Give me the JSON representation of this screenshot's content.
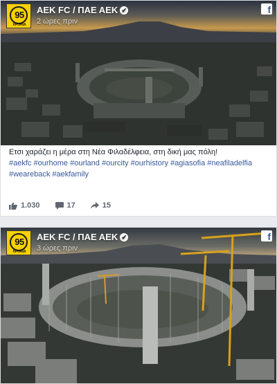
{
  "posts": [
    {
      "page_name": "AEK FC / ΠΑΕ ΑΕΚ",
      "time": "2 ώρες πριν",
      "avatar_number": "95",
      "avatar_text": "ΧΡΟΝΙΑ",
      "text": "Ετσι χαράζει η μέρα στη Νέα Φιλαδέλφεια, στη δική μας πόλη!",
      "hashtags_line1": [
        "#aekfc",
        "#ourhome",
        "#ourland",
        "#ourcity",
        "#ourhistory",
        "#agiasofia",
        "#neafiladelfia"
      ],
      "hashtags_line2": [
        "#weareback",
        "#aekfamily"
      ],
      "likes": "1.030",
      "comments": "17",
      "shares": "15"
    },
    {
      "page_name": "AEK FC / ΠΑΕ ΑΕΚ",
      "time": "3 ώρες πριν",
      "avatar_number": "95",
      "avatar_text": "ΧΡΟΝΙΑ"
    }
  ],
  "colors": {
    "hashtag": "#365899",
    "avatar_yellow": "#f8d100",
    "facebook_blue": "#3b5998"
  },
  "icons": {
    "like": "thumbs-up-icon",
    "comment": "comment-icon",
    "share": "share-arrow-icon",
    "network": "facebook-icon",
    "verified": "verified-badge-icon"
  }
}
